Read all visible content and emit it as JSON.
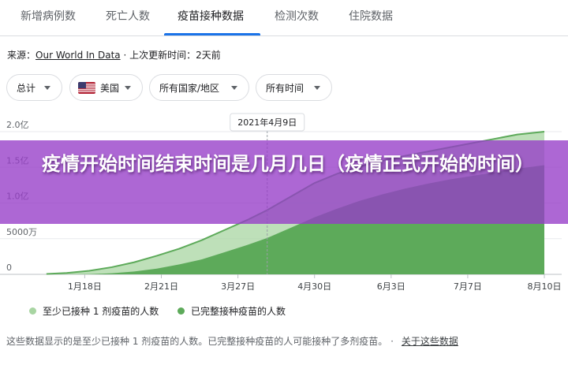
{
  "tabs": [
    {
      "label": "新增病例数"
    },
    {
      "label": "死亡人数"
    },
    {
      "label": "疫苗接种数据"
    },
    {
      "label": "检测次数"
    },
    {
      "label": "住院数据"
    }
  ],
  "source": {
    "prefix": "来源：",
    "link": "Our World In Data",
    "separator": "·",
    "updated": "上次更新时间：2天前"
  },
  "filters": {
    "total": "总计",
    "country": "美国",
    "regions": "所有国家/地区",
    "time": "所有时间"
  },
  "colors": {
    "accent": "#1a73e8",
    "dose1": "#a8d5a2",
    "full": "#5daa5a",
    "banner": "#963cc8"
  },
  "chart_data": {
    "type": "area",
    "tooltip_date": "2021年4月9日",
    "y_ticks": [
      "2.0亿",
      "1.5亿",
      "1.0亿",
      "5000万",
      "0"
    ],
    "y_values": [
      200000000,
      150000000,
      100000000,
      50000000,
      0
    ],
    "ylim": [
      0,
      200000000
    ],
    "x_ticks": [
      "1月18日",
      "2月21日",
      "3月27日",
      "4月30日",
      "6月3日",
      "7月7日",
      "8月10日"
    ],
    "x_days": [
      18,
      52,
      86,
      120,
      154,
      188,
      222
    ],
    "series": [
      {
        "name": "至少已接种 1 剂疫苗的人数",
        "color": "#a8d5a2",
        "x": [
          1,
          10,
          20,
          30,
          40,
          50,
          60,
          70,
          80,
          90,
          99,
          110,
          120,
          130,
          140,
          150,
          160,
          170,
          180,
          190,
          200,
          210,
          222
        ],
        "values": [
          500000,
          2000000,
          5000000,
          10000000,
          17000000,
          26000000,
          36000000,
          48000000,
          62000000,
          76000000,
          90000000,
          110000000,
          128000000,
          141000000,
          151000000,
          159000000,
          166000000,
          172000000,
          178000000,
          184000000,
          190000000,
          196000000,
          200000000
        ]
      },
      {
        "name": "已完整接种疫苗的人数",
        "color": "#5daa5a",
        "x": [
          1,
          20,
          30,
          40,
          50,
          60,
          70,
          80,
          90,
          99,
          110,
          120,
          130,
          140,
          150,
          160,
          170,
          180,
          190,
          200,
          210,
          222
        ],
        "values": [
          0,
          300000,
          1500000,
          4000000,
          8000000,
          14000000,
          21000000,
          31000000,
          41000000,
          51000000,
          66000000,
          80000000,
          92000000,
          103000000,
          112000000,
          120000000,
          127000000,
          133000000,
          138000000,
          143000000,
          148000000,
          153000000
        ]
      }
    ],
    "marker_x": 99
  },
  "banner": {
    "title": "疫情开始时间结束时间是几月几日（疫情正式开始的时间）"
  },
  "footnote": {
    "text": "这些数据显示的是至少已接种 1 剂疫苗的人数。已完整接种疫苗的人可能接种了多剂疫苗。 ·",
    "link": "关于这些数据"
  }
}
